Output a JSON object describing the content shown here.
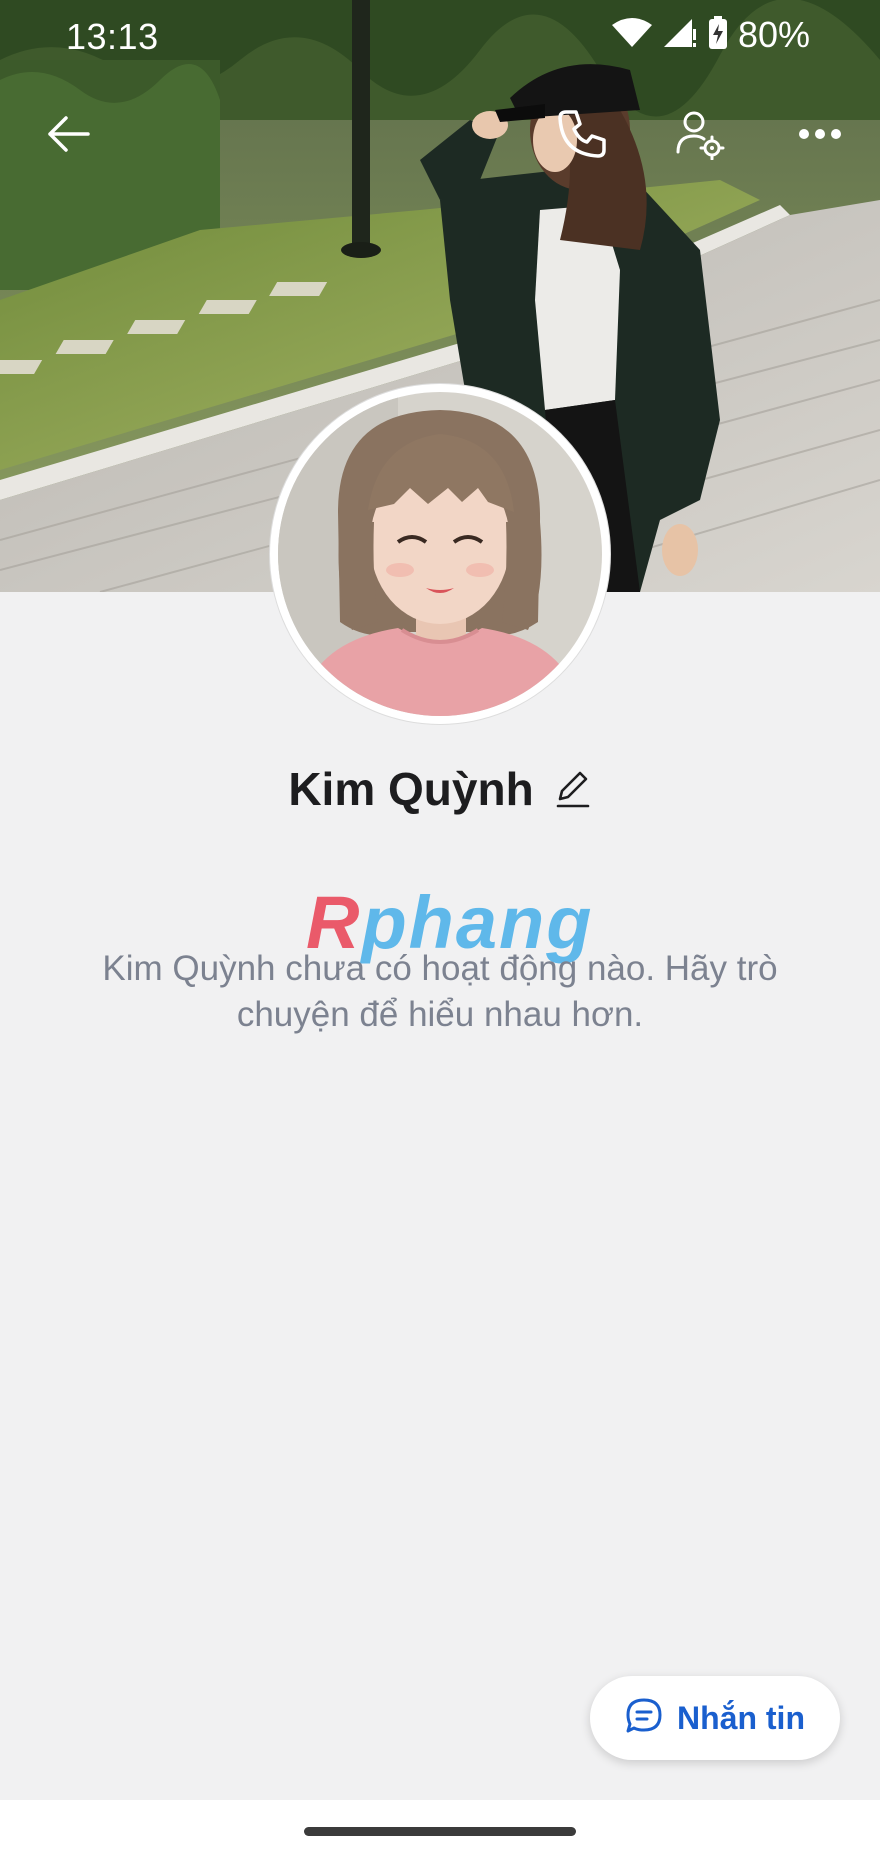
{
  "status_bar": {
    "time": "13:13",
    "battery": "80%",
    "icons": [
      "wifi-icon",
      "signal-icon",
      "battery-charging-icon"
    ]
  },
  "toolbar": {
    "back_icon": "arrow-left-icon",
    "call_icon": "phone-icon",
    "settings_icon": "user-settings-icon",
    "more_icon": "more-horizontal-icon"
  },
  "profile": {
    "name": "Kim Quỳnh",
    "edit_icon": "pencil-icon",
    "empty_message": "Kim Quỳnh chưa có hoạt động nào. Hãy trò chuyện để hiểu nhau hơn."
  },
  "watermark": {
    "part1": "R",
    "part2": "phang"
  },
  "message_button": {
    "label": "Nhắn tin",
    "icon": "chat-bubble-icon"
  },
  "colors": {
    "background": "#f1f1f2",
    "accent": "#1a5fce",
    "muted_text": "#7c8290",
    "name_text": "#1d1d1f"
  }
}
